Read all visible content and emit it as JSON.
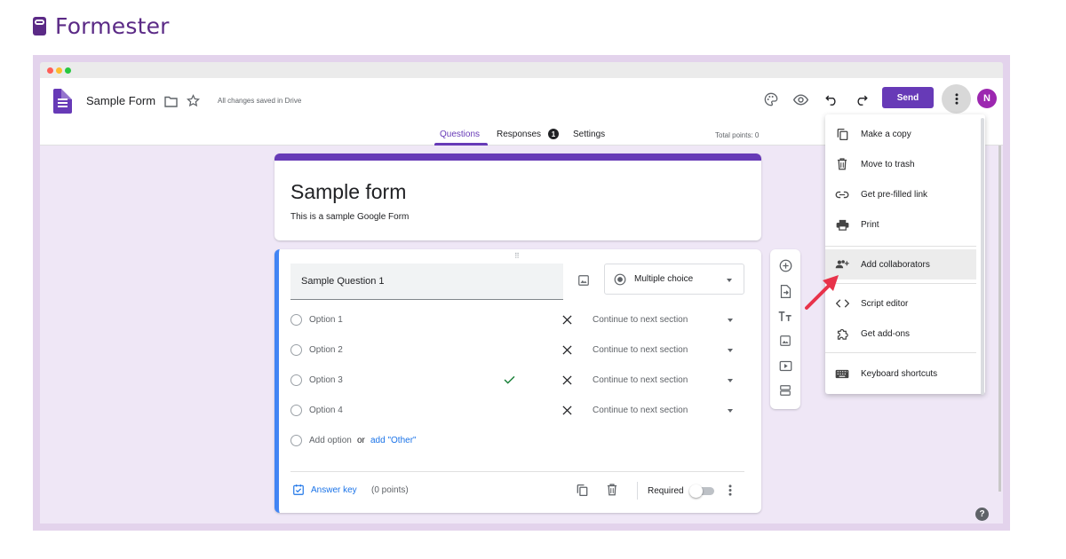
{
  "brand": {
    "name": "Formester"
  },
  "doc": {
    "title": "Sample Form",
    "status": "All changes saved in Drive"
  },
  "toolbar": {
    "send_label": "Send",
    "avatar_initial": "N"
  },
  "tabs": [
    {
      "label": "Questions",
      "active": true
    },
    {
      "label": "Responses",
      "badge": "1"
    },
    {
      "label": "Settings"
    }
  ],
  "total_points": "Total points: 0",
  "form": {
    "title": "Sample form",
    "description": "This is a sample Google Form"
  },
  "question": {
    "title": "Sample Question 1",
    "type": "Multiple choice",
    "options": [
      {
        "label": "Option 1",
        "section": "Continue to next section",
        "correct": false
      },
      {
        "label": "Option 2",
        "section": "Continue to next section",
        "correct": false
      },
      {
        "label": "Option 3",
        "section": "Continue to next section",
        "correct": true
      },
      {
        "label": "Option 4",
        "section": "Continue to next section",
        "correct": false
      }
    ],
    "add_option": "Add option",
    "or": "or",
    "add_other": "add \"Other\"",
    "answer_key": "Answer key",
    "points": "(0 points)",
    "required": "Required"
  },
  "menu": {
    "items": [
      {
        "label": "Make a copy",
        "icon": "copy-icon"
      },
      {
        "label": "Move to trash",
        "icon": "trash-icon"
      },
      {
        "label": "Get pre-filled link",
        "icon": "link-icon"
      },
      {
        "label": "Print",
        "icon": "print-icon"
      },
      {
        "label": "Add collaborators",
        "icon": "add-people-icon",
        "highlighted": true
      },
      {
        "label": "Script editor",
        "icon": "code-icon"
      },
      {
        "label": "Get add-ons",
        "icon": "puzzle-icon"
      },
      {
        "label": "Keyboard shortcuts",
        "icon": "keyboard-icon"
      }
    ]
  },
  "help": {
    "label": "?"
  },
  "colors": {
    "brand": "#5b2a86",
    "accent": "#673ab7",
    "link": "#1a73e8",
    "arrow": "#e8334a",
    "frame": "#e3d3ec"
  }
}
